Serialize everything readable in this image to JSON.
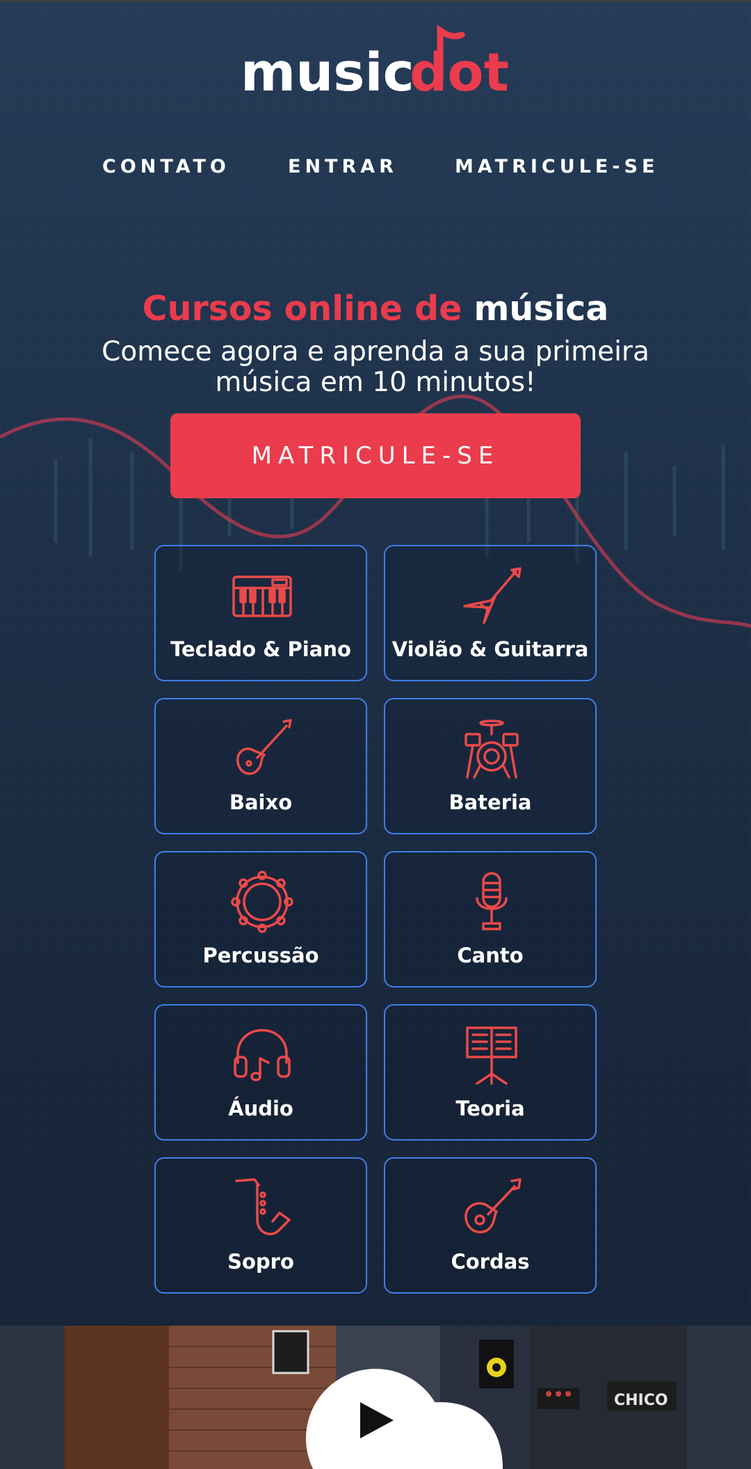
{
  "brand": {
    "name_part1": "music",
    "name_part2": "dot",
    "primary_color": "#ea3c4c",
    "background_color": "#1b2a3f",
    "card_border_color": "#3f7fe8"
  },
  "nav": {
    "items": [
      {
        "label": "CONTATO"
      },
      {
        "label": "ENTRAR"
      },
      {
        "label": "MATRICULE-SE"
      }
    ]
  },
  "hero": {
    "title_red": "Cursos online de",
    "title_white": "música",
    "subtitle": "Comece agora e aprenda a sua primeira música em 10 minutos!",
    "cta_label": "MATRICULE-SE"
  },
  "courses": [
    {
      "label": "Teclado & Piano",
      "icon": "keyboard-icon"
    },
    {
      "label": "Violão & Guitarra",
      "icon": "electric-guitar-icon"
    },
    {
      "label": "Baixo",
      "icon": "bass-guitar-icon"
    },
    {
      "label": "Bateria",
      "icon": "drum-kit-icon"
    },
    {
      "label": "Percussão",
      "icon": "tambourine-icon"
    },
    {
      "label": "Canto",
      "icon": "microphone-icon"
    },
    {
      "label": "Áudio",
      "icon": "headphones-icon"
    },
    {
      "label": "Teoria",
      "icon": "music-stand-icon"
    },
    {
      "label": "Sopro",
      "icon": "saxophone-icon"
    },
    {
      "label": "Cordas",
      "icon": "ukulele-icon"
    }
  ],
  "video": {
    "icon": "play-icon",
    "poster_sign_text": "CHICO"
  }
}
